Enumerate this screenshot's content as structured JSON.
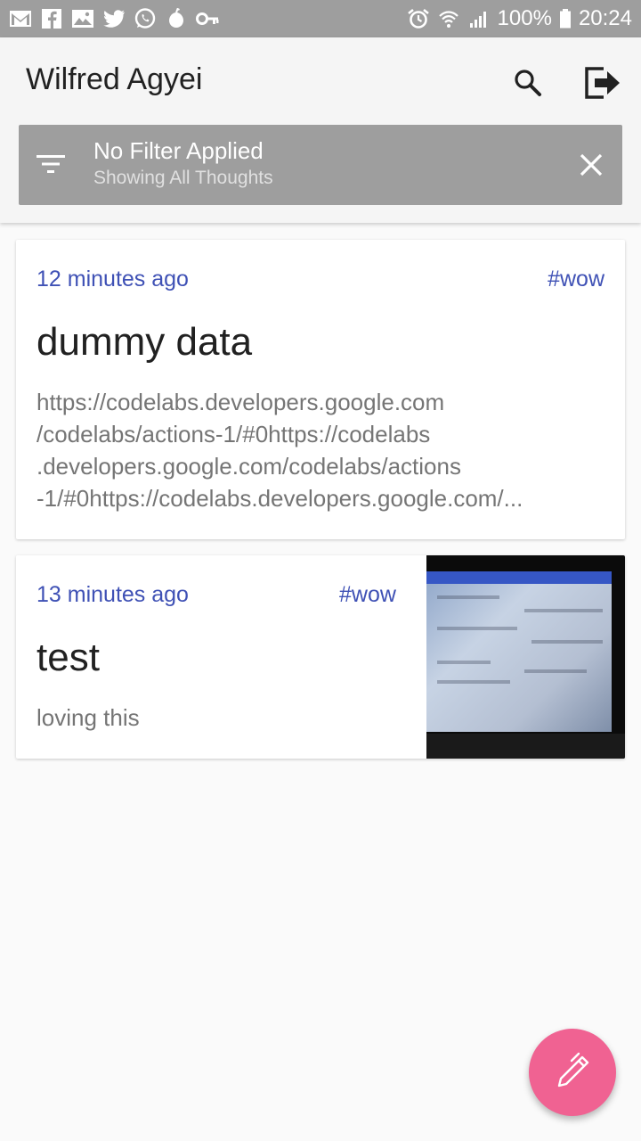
{
  "status_bar": {
    "left_icons": [
      "gmail-icon",
      "facebook-icon",
      "gallery-icon",
      "twitter-icon",
      "whatsapp-icon",
      "drop-icon",
      "key-icon"
    ],
    "battery": "100%",
    "time": "20:24"
  },
  "app_bar": {
    "title": "Wilfred Agyei"
  },
  "filter": {
    "title": "No Filter Applied",
    "subtitle": "Showing All Thoughts"
  },
  "thoughts": [
    {
      "time": "12 minutes ago",
      "tag": "#wow",
      "title": "dummy data",
      "body_lines": [
        "https://codelabs.developers.google.com",
        "/codelabs/actions-1/#0https://codelabs",
        ".developers.google.com/codelabs/actions",
        "-1/#0https://codelabs.developers.google.com/..."
      ]
    },
    {
      "time": "13 minutes ago",
      "tag": "#wow",
      "title": "test",
      "body": "loving this",
      "has_image": true
    }
  ],
  "colors": {
    "accent": "#3f51b5",
    "fab": "#f06292",
    "status_bar": "#9e9e9e",
    "filter_bar": "#9e9e9e"
  }
}
